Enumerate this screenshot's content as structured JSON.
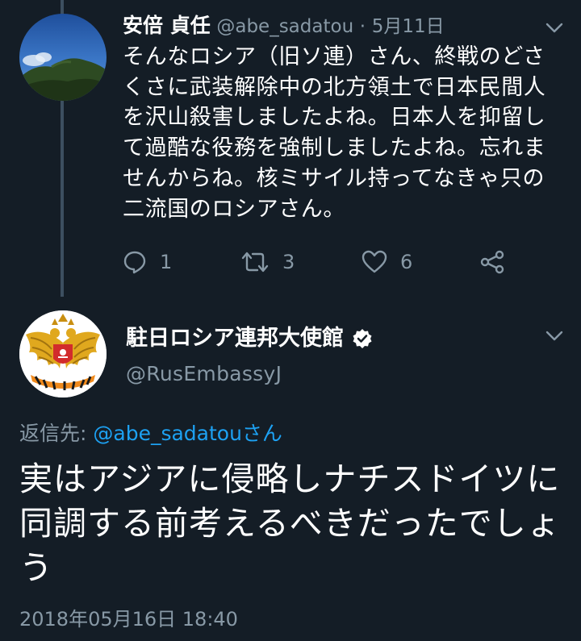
{
  "tweet1": {
    "display_name": "安倍 貞任",
    "handle": "@abe_sadatou",
    "separator": "·",
    "date": "5月11日",
    "text": "そんなロシア（旧ソ連）さん、終戦のどさくさに武装解除中の北方領土で日本民間人を沢山殺害しましたよね。日本人を抑留して過酷な役務を強制しましたよね。忘れませんからね。核ミサイル持ってなきゃ只の二流国のロシアさん。",
    "reply_count": "1",
    "retweet_count": "3",
    "like_count": "6"
  },
  "tweet2": {
    "display_name": "駐日ロシア連邦大使館",
    "handle": "@RusEmbassyJ",
    "reply_prefix": "返信先: ",
    "reply_user": "@abe_sadatou",
    "reply_suffix": "さん",
    "text": "実はアジアに侵略しナチスドイツに同調する前考えるべきだったでしょう",
    "timestamp": "2018年05月16日 18:40"
  },
  "icons": {
    "reply": "reply-icon",
    "retweet": "retweet-icon",
    "like": "heart-icon",
    "share": "share-icon",
    "menu": "chevron-down-icon",
    "verified": "verified-badge-icon"
  },
  "colors": {
    "background": "#141d26",
    "text": "#ffffff",
    "secondary": "#8899a6",
    "link": "#1da1f2",
    "thread_line": "#3d4f60"
  }
}
